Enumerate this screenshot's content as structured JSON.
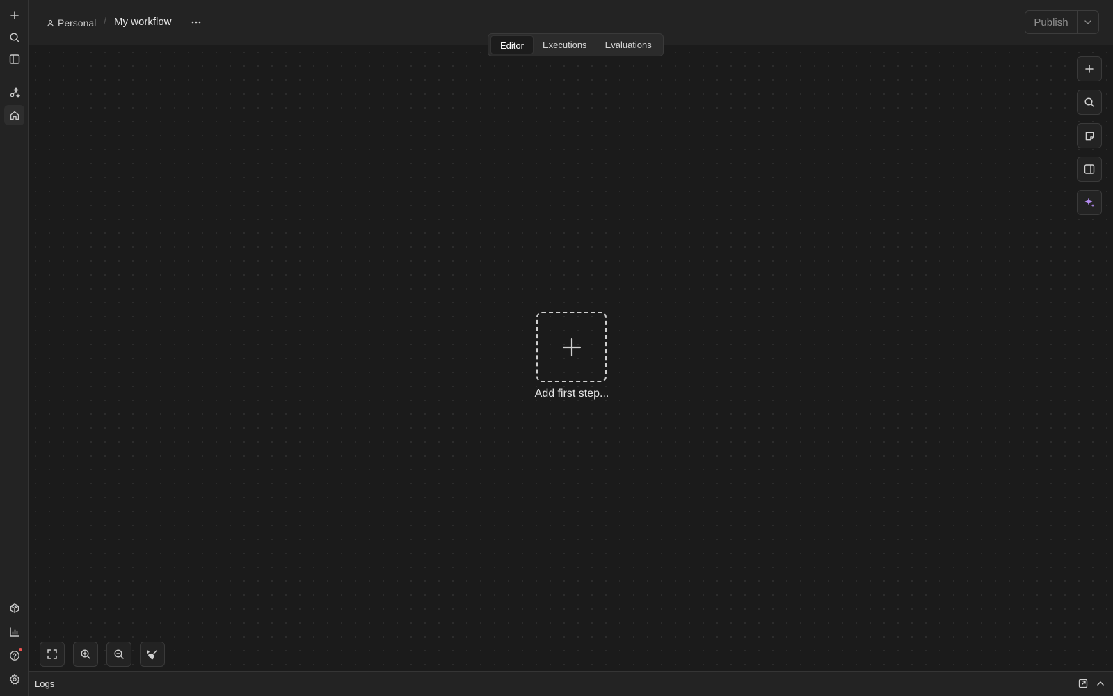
{
  "header": {
    "project": "Personal",
    "separator": "/",
    "workflow_title": "My workflow",
    "tabs": [
      {
        "label": "Editor",
        "active": true
      },
      {
        "label": "Executions",
        "active": false
      },
      {
        "label": "Evaluations",
        "active": false
      }
    ],
    "publish_label": "Publish"
  },
  "sidebar": {
    "icons": [
      "plus-icon",
      "search-icon",
      "panel-toggle-icon",
      "sparkle-nodes-icon",
      "home-icon",
      "templates-icon",
      "insights-icon",
      "help-icon",
      "settings-icon"
    ],
    "active_item": "home-icon"
  },
  "canvas": {
    "add_step_label": "Add first step...",
    "right_tools": [
      "plus-icon",
      "search-icon",
      "sticky-note-icon",
      "panel-icon",
      "ai-sparkle-icon"
    ],
    "bottom_tools": [
      "fit-view-icon",
      "zoom-in-icon",
      "zoom-out-icon",
      "cleanup-icon"
    ]
  },
  "logs": {
    "label": "Logs"
  },
  "colors": {
    "background": "#1b1b1b",
    "panel": "#232323",
    "border": "#353535",
    "ai_accent": "#b48cf0",
    "notification": "#ef5350"
  }
}
